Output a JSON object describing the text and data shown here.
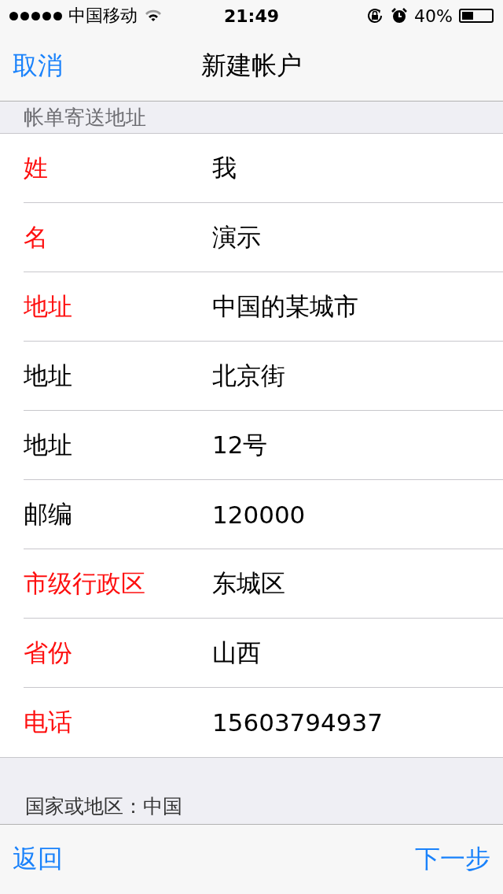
{
  "status_bar": {
    "carrier": "中国移动",
    "time": "21:49",
    "battery_text": "40%"
  },
  "nav": {
    "left": "取消",
    "title": "新建帐户"
  },
  "section_header": "帐单寄送地址",
  "fields": [
    {
      "label": "姓",
      "value": "我",
      "required": true
    },
    {
      "label": "名",
      "value": "演示",
      "required": true
    },
    {
      "label": "地址",
      "value": "中国的某城市",
      "required": true
    },
    {
      "label": "地址",
      "value": "北京街",
      "required": false
    },
    {
      "label": "地址",
      "value": "12号",
      "required": false
    },
    {
      "label": "邮编",
      "value": "120000",
      "required": false
    },
    {
      "label": "市级行政区",
      "value": "东城区",
      "required": true
    },
    {
      "label": "省份",
      "value": "山西",
      "required": true
    },
    {
      "label": "电话",
      "value": "15603794937",
      "required": true
    }
  ],
  "footer": "国家或地区：中国",
  "toolbar": {
    "left": "返回",
    "right": "下一步"
  }
}
